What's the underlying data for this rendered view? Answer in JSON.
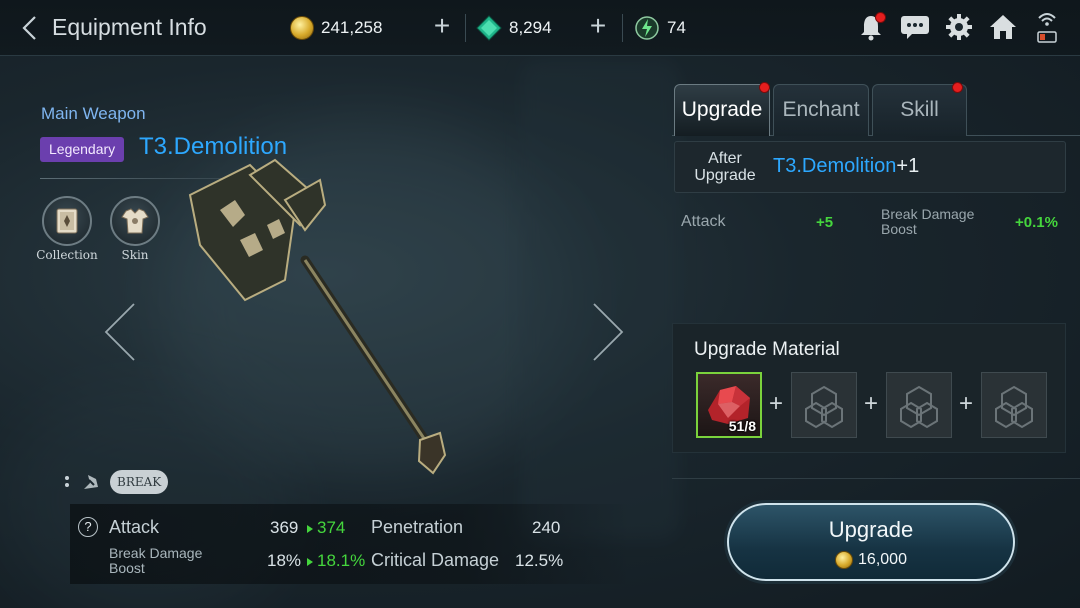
{
  "header": {
    "title": "Equipment Info",
    "gold": "241,258",
    "gems": "8,294",
    "energy": "74"
  },
  "weapon": {
    "slot": "Main Weapon",
    "rarity": "Legendary",
    "name": "T3.Demolition",
    "collection_label": "Collection",
    "skin_label": "Skin",
    "break_label": "BREAK"
  },
  "stats": {
    "attack_label": "Attack",
    "attack_value": "369",
    "attack_next": "374",
    "break_label": "Break Damage Boost",
    "break_value": "18%",
    "break_next": "18.1%",
    "penetration_label": "Penetration",
    "penetration_value": "240",
    "crit_label": "Critical Damage",
    "crit_value": "12.5%"
  },
  "tabs": [
    "Upgrade",
    "Enchant",
    "Skill"
  ],
  "after": {
    "label": "After Upgrade",
    "name": "T3.Demolition",
    "level": "+1",
    "attack_label": "Attack",
    "attack_gain": "+5",
    "break_label": "Break Damage Boost",
    "break_gain": "+0.1%"
  },
  "materials": {
    "title": "Upgrade Material",
    "count": "51/8"
  },
  "upgrade_button": {
    "label": "Upgrade",
    "cost": "16,000"
  },
  "colors": {
    "accent_blue": "#2da8ff",
    "gain_green": "#45d63d",
    "legendary_purple": "#6b3fae"
  }
}
